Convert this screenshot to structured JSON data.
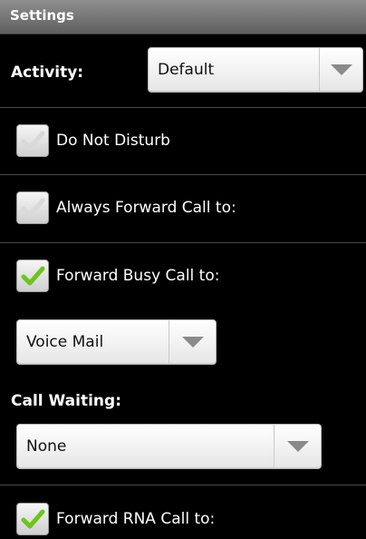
{
  "header": {
    "title": "Settings"
  },
  "activity": {
    "label": "Activity:",
    "value": "Default"
  },
  "options": {
    "dnd": {
      "label": "Do Not Disturb",
      "checked": false
    },
    "always_forward": {
      "label": "Always Forward Call to:",
      "checked": false
    },
    "forward_busy": {
      "label": "Forward Busy Call to:",
      "checked": true,
      "destination": "Voice Mail"
    },
    "forward_rna": {
      "label": "Forward RNA Call to:",
      "checked": true
    }
  },
  "call_waiting": {
    "label": "Call Waiting:",
    "value": "None"
  },
  "colors": {
    "check_enabled": "#6cc51c",
    "check_disabled": "#d4d4d4",
    "title_bar": "#7a7a7a"
  },
  "icons": {
    "spinner_arrow": "chevron-down-icon",
    "check": "checkmark-icon"
  }
}
